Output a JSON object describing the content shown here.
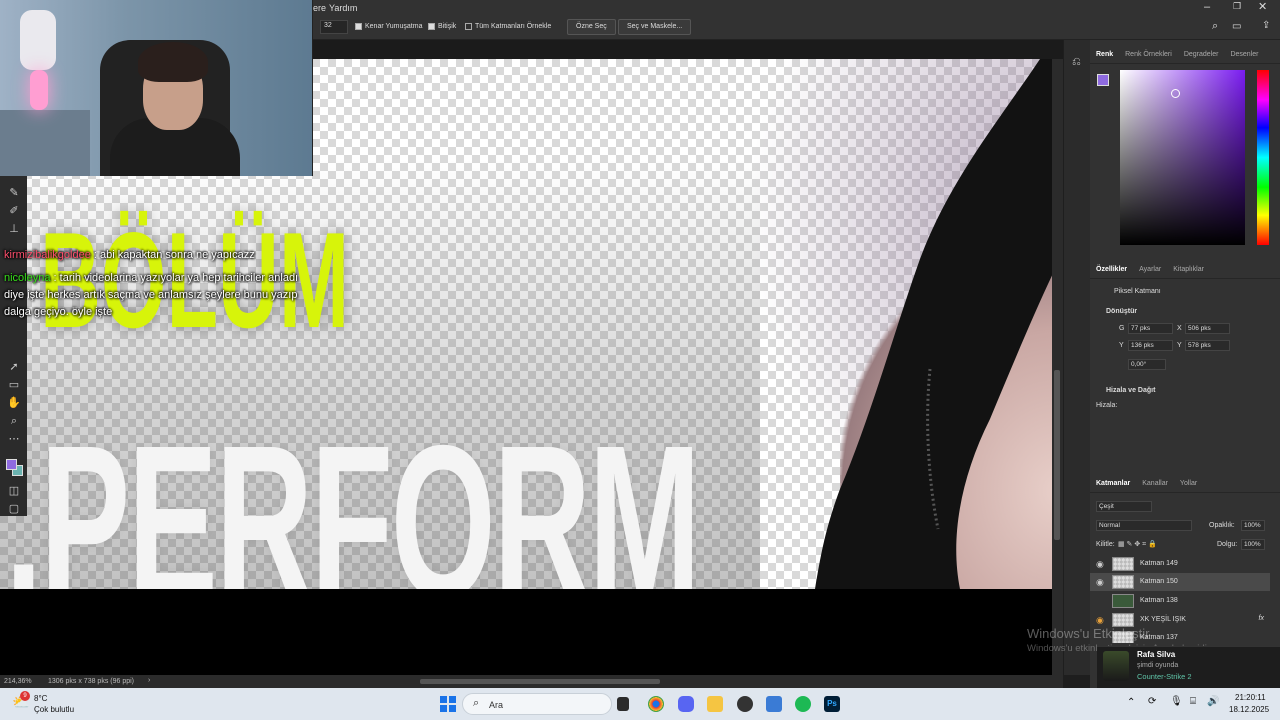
{
  "menubar": {
    "left_label": "ere",
    "yardim": "Yardım"
  },
  "options": {
    "size_value": "32",
    "kenar_label": "Kenar Yumuşatma",
    "bitisik_label": "Bitişik",
    "tum_label": "Tüm Katmanları Örnekle",
    "ozne_button": "Özne Seç",
    "sec_maskele_button": "Seç ve Maskele..."
  },
  "canvas": {
    "bolum": "BÖLÜM",
    "perform": ".PERFORM"
  },
  "chat": [
    {
      "user": "kirmizibalikgoldee",
      "sep": " : ",
      "text": "abi kapaktan sonra ne yapıcazz"
    },
    {
      "user": "nicoleyna",
      "sep": " : ",
      "text": "tarih videolarina yazıyolar ya hep tarihciler anladı diye işte herkes artık saçma ve anlamsız şeylere bunu yazıp dalga geçiyo. öyle işte"
    }
  ],
  "status": {
    "zoom": "214,36%",
    "doc_info": "1306 pks x 738 pks (96 ppi)"
  },
  "panel": {
    "color_tabs": [
      "Renk",
      "Renk Örnekleri",
      "Degradeler",
      "Desenler"
    ],
    "prop_tabs": [
      "Özellikler",
      "Ayarlar",
      "Kitaplıklar"
    ],
    "pixel_layer": "Piksel Katmanı",
    "transform_head": "Dönüştür",
    "w_label": "G",
    "w_value": "77 pks",
    "x_label": "X",
    "x_value": "506 pks",
    "h_label": "Y",
    "h_value": "136 pks",
    "y_label": "Y",
    "y_value": "578 pks",
    "angle_value": "0,00°",
    "align_head": "Hizala ve Dağıt",
    "align_label": "Hizala:",
    "layer_tabs": [
      "Katmanlar",
      "Kanallar",
      "Yollar"
    ],
    "filter_label": "Çeşit",
    "blend_mode": "Normal",
    "opacity_label": "Opaklık:",
    "opacity_value": "100%",
    "lock_label": "Kilitle:",
    "fill_label": "Dolgu:",
    "fill_value": "100%",
    "layers": [
      {
        "name": "Katman 149"
      },
      {
        "name": "Katman 150"
      },
      {
        "name": "Katman 138"
      },
      {
        "name": "XK YEŞİL IŞIK",
        "fx": "fx"
      },
      {
        "name": "Katman 137"
      }
    ]
  },
  "watermark": {
    "line1": "Windows'u Etkinleştir",
    "line2": "Windows'u etkinleştirmek için Ayarlar'a gidin."
  },
  "spotify": {
    "artist": "Rafa Silva",
    "status": "şimdi oyunda",
    "game": "Counter-Strike 2"
  },
  "taskbar": {
    "weather_temp": "8°C",
    "weather_desc": "Çok bulutlu",
    "weather_badge": "9",
    "search_placeholder": "Ara",
    "time": "21:20:11",
    "date": "18.12.2025"
  }
}
